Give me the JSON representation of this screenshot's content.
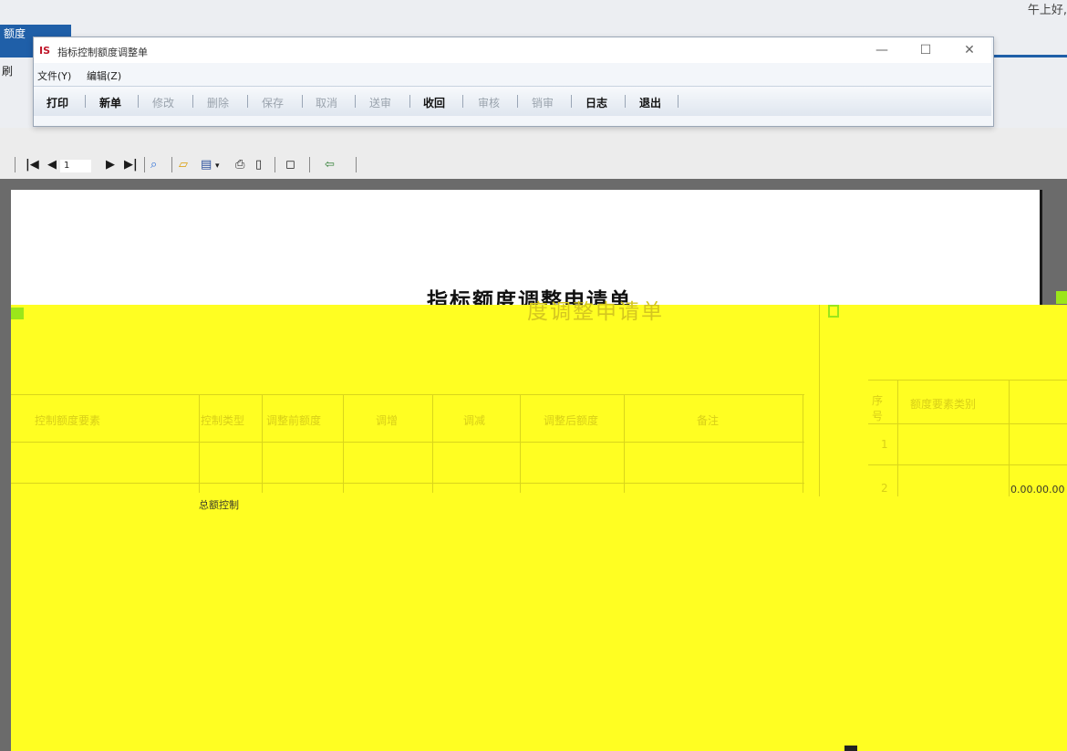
{
  "background_app": {
    "tab_label": "额度",
    "left_label": "刷",
    "top_right_text": "午上好,"
  },
  "window": {
    "title": "指标控制额度调整单",
    "controls": {
      "minimize": "—",
      "maximize": "☐",
      "close": "✕"
    },
    "menu": [
      {
        "label": "文件(Y)"
      },
      {
        "label": "编辑(Z)"
      }
    ],
    "toolbar": [
      {
        "label": "打印",
        "enabled": true
      },
      {
        "label": "新单",
        "enabled": true
      },
      {
        "label": "修改",
        "enabled": false
      },
      {
        "label": "删除",
        "enabled": false
      },
      {
        "label": "保存",
        "enabled": false
      },
      {
        "label": "取消",
        "enabled": false
      },
      {
        "label": "送审",
        "enabled": false
      },
      {
        "label": "收回",
        "enabled": true
      },
      {
        "label": "审核",
        "enabled": false
      },
      {
        "label": "销审",
        "enabled": false
      },
      {
        "label": "日志",
        "enabled": true
      },
      {
        "label": "退出",
        "enabled": true
      }
    ]
  },
  "report_viewer": {
    "page_number": "1",
    "icons": [
      "first-page-icon",
      "prev-page-icon",
      "next-page-icon",
      "last-page-icon",
      "search-icon",
      "open-icon",
      "save-icon",
      "print-icon",
      "page-setup-icon",
      "fit-page-icon",
      "exit-icon"
    ]
  },
  "report": {
    "title": "指标额度调整申请单",
    "table_headers": [
      "控制额度要素",
      "控制类型",
      "调整前额度",
      "调增",
      "调减",
      "调整后额度",
      "备注"
    ],
    "right_table_headers": [
      "序号",
      "额度要素类别"
    ],
    "right_row_numbers": [
      "1",
      "2"
    ],
    "right_cell_value": "0.00.00.00",
    "row_type": "总额控制"
  },
  "colors": {
    "accent": "#1f5fa8",
    "overlay": "#fffe22",
    "marker": "#9be61a"
  }
}
